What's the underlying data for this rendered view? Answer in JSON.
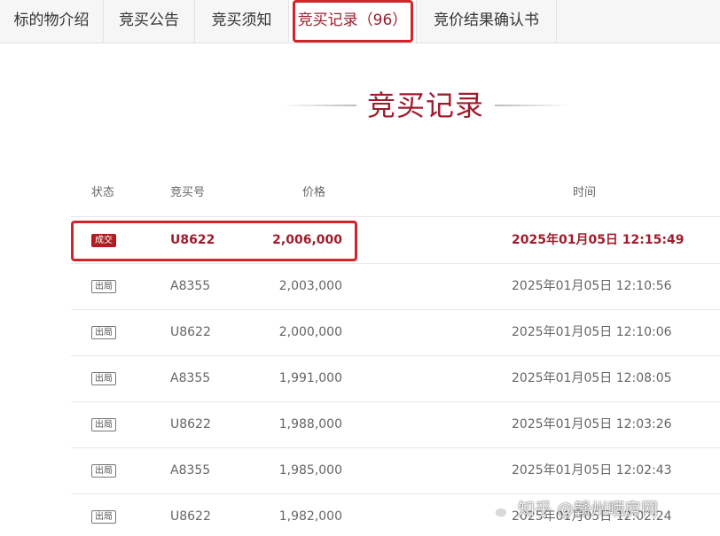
{
  "tabs": [
    {
      "label": "标的物介绍"
    },
    {
      "label": "竞买公告"
    },
    {
      "label": "竞买须知"
    },
    {
      "label": "竞买记录（96）"
    },
    {
      "label": "竞价结果确认书"
    }
  ],
  "section_title": "竞买记录",
  "table": {
    "headers": {
      "status": "状态",
      "bidder_id": "竞买号",
      "price": "价格",
      "time": "时间"
    },
    "rows": [
      {
        "status": "成交",
        "bidder_id": "U8622",
        "price": "2,006,000",
        "time": "2025年01月05日 12:15:49"
      },
      {
        "status": "出局",
        "bidder_id": "A8355",
        "price": "2,003,000",
        "time": "2025年01月05日 12:10:56"
      },
      {
        "status": "出局",
        "bidder_id": "U8622",
        "price": "2,000,000",
        "time": "2025年01月05日 12:10:06"
      },
      {
        "status": "出局",
        "bidder_id": "A8355",
        "price": "1,991,000",
        "time": "2025年01月05日 12:08:05"
      },
      {
        "status": "出局",
        "bidder_id": "U8622",
        "price": "1,988,000",
        "time": "2025年01月05日 12:03:26"
      },
      {
        "status": "出局",
        "bidder_id": "A8355",
        "price": "1,985,000",
        "time": "2025年01月05日 12:02:43"
      },
      {
        "status": "出局",
        "bidder_id": "U8622",
        "price": "1,982,000",
        "time": "2025年01月05日 12:02:24"
      }
    ]
  },
  "watermark": {
    "icon": "wechat-icon",
    "text": "知乎 @赣州晒房网"
  },
  "colors": {
    "accent": "#a01c2c",
    "highlight_box": "#d3232b",
    "win_badge": "#b01c22"
  }
}
